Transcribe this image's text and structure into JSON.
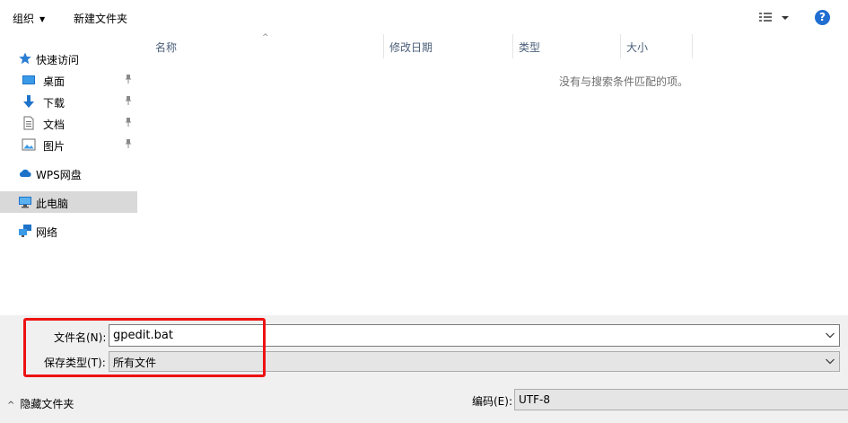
{
  "toolbar": {
    "organize_label": "组织",
    "new_folder_label": "新建文件夹",
    "help_label": "?"
  },
  "sidebar": {
    "quick_access": "快速访问",
    "items": [
      {
        "label": "桌面",
        "icon": "desktop-icon",
        "pinned": true
      },
      {
        "label": "下载",
        "icon": "download-icon",
        "pinned": true
      },
      {
        "label": "文档",
        "icon": "document-icon",
        "pinned": true
      },
      {
        "label": "图片",
        "icon": "pictures-icon",
        "pinned": true
      }
    ],
    "wps_drive": "WPS网盘",
    "this_pc": "此电脑",
    "network": "网络"
  },
  "columns": [
    "名称",
    "修改日期",
    "类型",
    "大小"
  ],
  "empty_message": "没有与搜索条件匹配的项。",
  "filename": {
    "label": "文件名(N):",
    "value": "gpedit.bat"
  },
  "filetype": {
    "label": "保存类型(T):",
    "value": "所有文件"
  },
  "hide_folders_label": "隐藏文件夹",
  "encoding": {
    "label": "编码(E):",
    "value": "UTF-8"
  },
  "colors": {
    "accent": "#1f6ed0",
    "highlight": "#ee1111",
    "selected": "#d9d9d9"
  }
}
